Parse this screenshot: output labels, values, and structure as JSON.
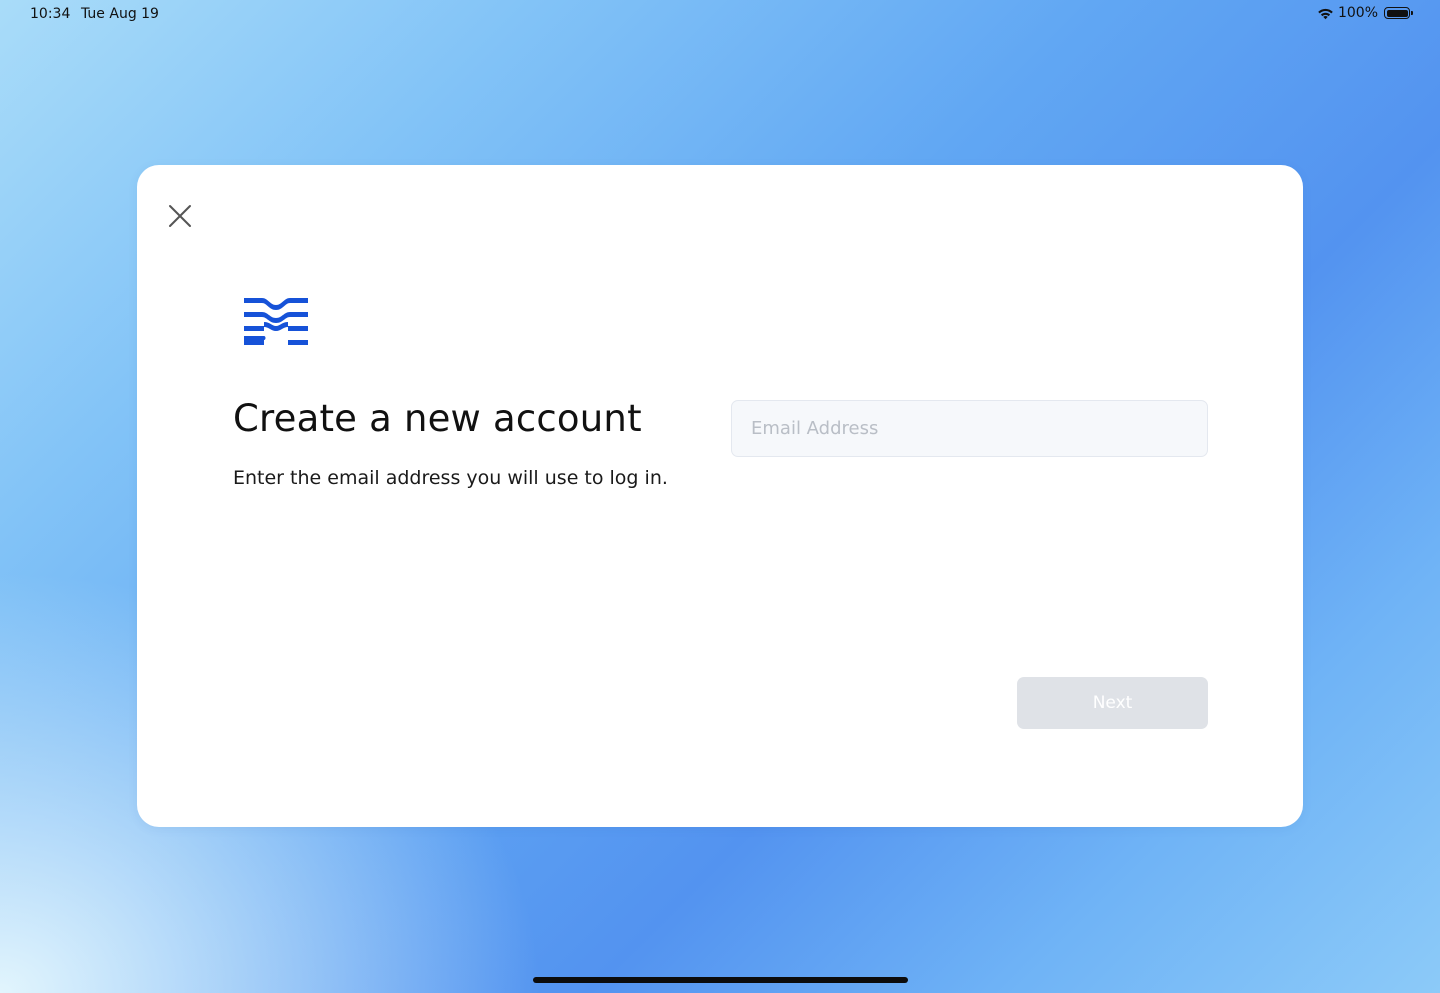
{
  "status_bar": {
    "time": "10:34",
    "date": "Tue Aug 19",
    "battery_text": "100%",
    "battery_level": 1.0,
    "wifi_icon": "wifi-icon",
    "battery_icon": "battery-icon"
  },
  "dialog": {
    "close_icon": "close-icon",
    "logo_icon": "brand-logo",
    "title": "Create a new account",
    "subtitle": "Enter the email address you will use to log in.",
    "email_input": {
      "placeholder": "Email Address",
      "value": ""
    },
    "next_label": "Next"
  },
  "colors": {
    "logo_blue": "#1652d8",
    "button_disabled_bg": "#dfe2e7",
    "input_bg": "#f6f8fb",
    "placeholder": "#b9bec6"
  }
}
